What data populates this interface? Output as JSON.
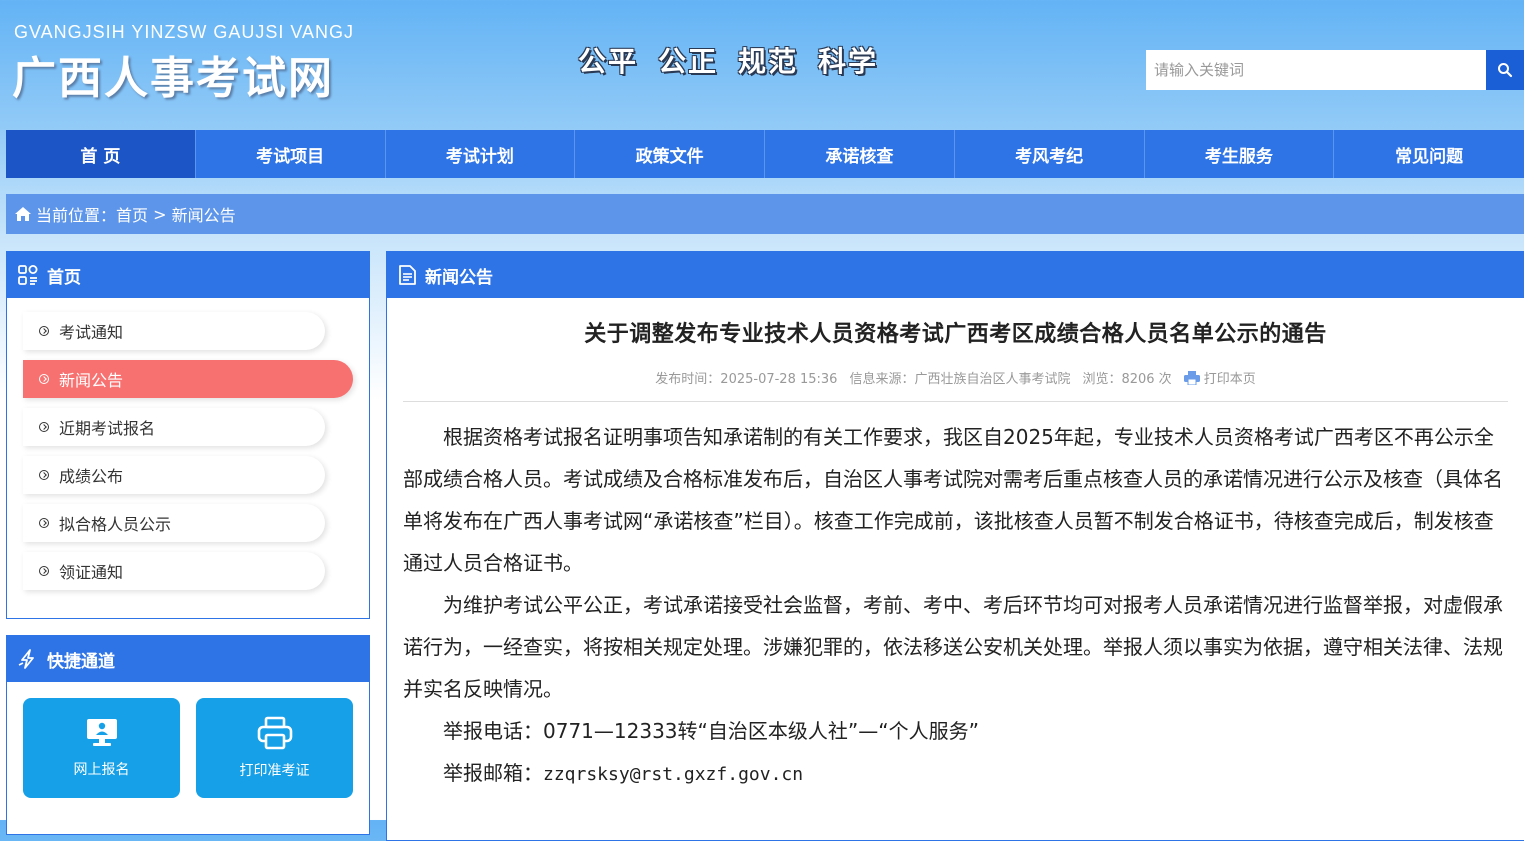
{
  "header": {
    "logo_pinyin": "GVANGJSIH YINZSW GAUJSI VANGJ",
    "logo_title": "广西人事考试网",
    "slogan": [
      "公平",
      "公正",
      "规范",
      "科学"
    ],
    "search_placeholder": "请输入关键词"
  },
  "nav": [
    {
      "label": "首 页",
      "active": true
    },
    {
      "label": "考试项目"
    },
    {
      "label": "考试计划"
    },
    {
      "label": "政策文件"
    },
    {
      "label": "承诺核查"
    },
    {
      "label": "考风考纪"
    },
    {
      "label": "考生服务"
    },
    {
      "label": "常见问题"
    }
  ],
  "breadcrumb": {
    "prefix": "当前位置：",
    "home": "首页",
    "separator": " > ",
    "current": "新闻公告"
  },
  "sidebar": {
    "title": "首页",
    "items": [
      {
        "label": "考试通知"
      },
      {
        "label": "新闻公告",
        "active": true
      },
      {
        "label": "近期考试报名"
      },
      {
        "label": "成绩公布"
      },
      {
        "label": "拟合格人员公示"
      },
      {
        "label": "领证通知"
      }
    ]
  },
  "quick": {
    "title": "快捷通道",
    "items": [
      {
        "label": "网上报名",
        "icon": "computer-user-icon"
      },
      {
        "label": "打印准考证",
        "icon": "printer-icon"
      }
    ]
  },
  "content": {
    "section_title": "新闻公告",
    "article_title": "关于调整发布专业技术人员资格考试广西考区成绩合格人员名单公示的通告",
    "meta": {
      "publish_time": "发布时间：2025-07-28 15:36",
      "source": "信息来源：广西壮族自治区人事考试院",
      "views": "浏览：8206 次",
      "print": "打印本页"
    },
    "paragraphs": [
      "根据资格考试报名证明事项告知承诺制的有关工作要求，我区自2025年起，专业技术人员资格考试广西考区不再公示全部成绩合格人员。考试成绩及合格标准发布后，自治区人事考试院对需考后重点核查人员的承诺情况进行公示及核查（具体名单将发布在广西人事考试网“承诺核查”栏目）。核查工作完成前，该批核查人员暂不制发合格证书，待核查完成后，制发核查通过人员合格证书。",
      "为维护考试公平公正，考试承诺接受社会监督，考前、考中、考后环节均可对报考人员承诺情况进行监督举报，对虚假承诺行为，一经查实，将按相关规定处理。涉嫌犯罪的，依法移送公安机关处理。举报人须以事实为依据，遵守相关法律、法规并实名反映情况。",
      "举报电话：0771—12333转“自治区本级人社”—“个人服务”"
    ],
    "email_label": "举报邮箱：",
    "email": "zzqrsksy@rst.gxzf.gov.cn"
  },
  "colors": {
    "primary": "#2e74e6",
    "nav_active": "#1c55c6",
    "side_active": "#f87171",
    "quick_button": "#16a0e8"
  }
}
